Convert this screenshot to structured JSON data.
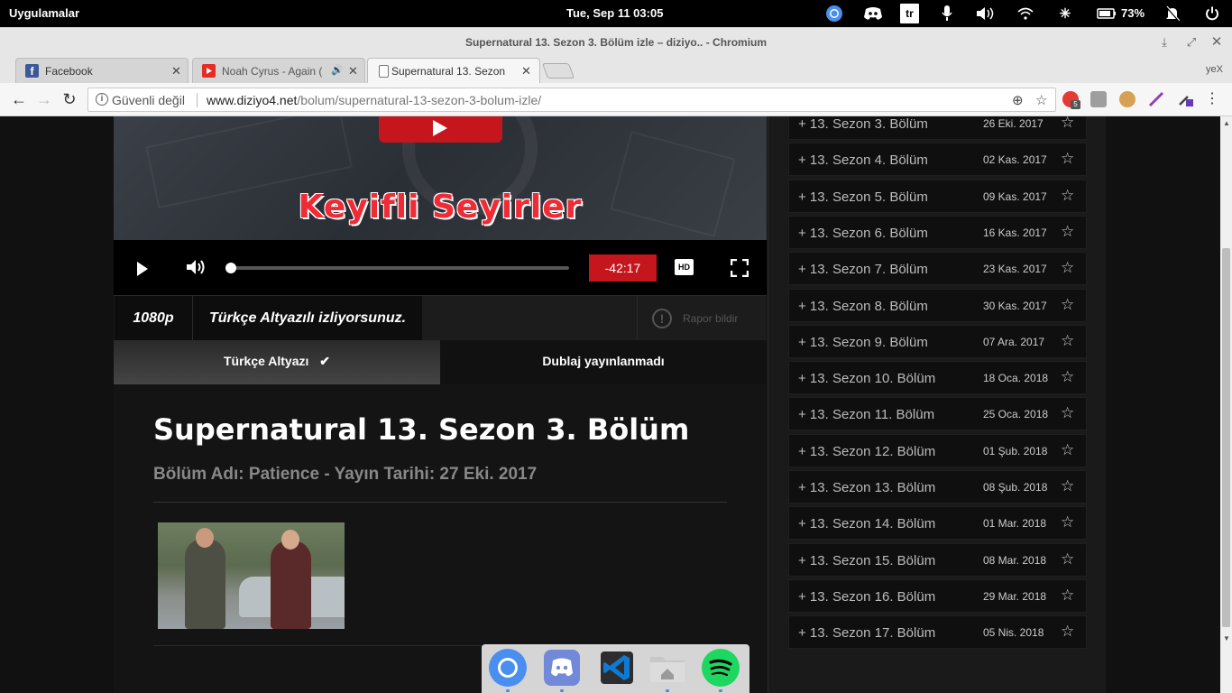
{
  "system_panel": {
    "apps_label": "Uygulamalar",
    "clock": "Tue, Sep 11    03:05",
    "lang_indicator": "tr",
    "battery": "73%",
    "icons": [
      "chromium-icon",
      "discord-icon",
      "keyboard-layout-icon",
      "microphone-icon",
      "volume-icon",
      "wifi-icon",
      "bluetooth-icon",
      "battery-icon",
      "notifications-off-icon",
      "power-icon"
    ]
  },
  "window": {
    "title": "Supernatural 13. Sezon 3. Bölüm izle – diziyo.. - Chromium",
    "profile": "yeX"
  },
  "tabs": [
    {
      "title": "Facebook",
      "favicon": "facebook-icon",
      "color": "#3b5998"
    },
    {
      "title": "Noah Cyrus - Again (",
      "favicon": "youtube-icon",
      "color": "#e52d27",
      "audio": true
    },
    {
      "title": "Supernatural 13. Sezon",
      "favicon": "page-icon",
      "color": "#ffffff",
      "active": true
    }
  ],
  "omnibox": {
    "security_label": "Güvenli değil",
    "url_host": "www.diziyo4.net",
    "url_path": "/bolum/supernatural-13-sezon-3-bolum-izle/",
    "extension_badge": "5"
  },
  "player": {
    "slogan": "Keyifli Seyirler",
    "time_remaining": "-42:17",
    "progress": 0.0,
    "hd_label": "HD",
    "quality": "1080p",
    "subtitle_status": "Türkçe Altyazılı izliyorsunuz.",
    "report_label": "Rapor bildir"
  },
  "language_tabs": {
    "subtitled": "Türkçe Altyazı",
    "dubbed": "Dublaj yayınlanmadı"
  },
  "episode": {
    "title": "Supernatural 13. Sezon 3. Bölüm",
    "subtitle": "Bölüm Adı: Patience - Yayın Tarihi: 27 Eki. 2017"
  },
  "episode_list": [
    {
      "label": "+ 13. Sezon 3. Bölüm",
      "date": "26 Eki. 2017"
    },
    {
      "label": "+ 13. Sezon 4. Bölüm",
      "date": "02 Kas. 2017"
    },
    {
      "label": "+ 13. Sezon 5. Bölüm",
      "date": "09 Kas. 2017"
    },
    {
      "label": "+ 13. Sezon 6. Bölüm",
      "date": "16 Kas. 2017"
    },
    {
      "label": "+ 13. Sezon 7. Bölüm",
      "date": "23 Kas. 2017"
    },
    {
      "label": "+ 13. Sezon 8. Bölüm",
      "date": "30 Kas. 2017"
    },
    {
      "label": "+ 13. Sezon 9. Bölüm",
      "date": "07 Ara. 2017"
    },
    {
      "label": "+ 13. Sezon 10. Bölüm",
      "date": "18 Oca. 2018"
    },
    {
      "label": "+ 13. Sezon 11. Bölüm",
      "date": "25 Oca. 2018"
    },
    {
      "label": "+ 13. Sezon 12. Bölüm",
      "date": "01 Şub. 2018"
    },
    {
      "label": "+ 13. Sezon 13. Bölüm",
      "date": "08 Şub. 2018"
    },
    {
      "label": "+ 13. Sezon 14. Bölüm",
      "date": "01 Mar. 2018"
    },
    {
      "label": "+ 13. Sezon 15. Bölüm",
      "date": "08 Mar. 2018"
    },
    {
      "label": "+ 13. Sezon 16. Bölüm",
      "date": "29 Mar. 2018"
    },
    {
      "label": "+ 13. Sezon 17. Bölüm",
      "date": "05 Nis. 2018"
    }
  ],
  "dock": [
    "chromium-icon",
    "discord-icon",
    "vscode-icon",
    "home-folder-icon",
    "spotify-icon"
  ],
  "colors": {
    "accent_red": "#c4161c",
    "page_bg": "#111111",
    "sidebar_bg": "#1a1a1a"
  }
}
